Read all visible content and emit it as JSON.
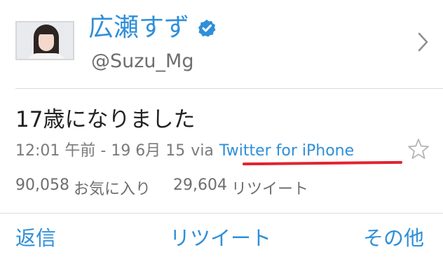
{
  "profile": {
    "display_name": "広瀬すず",
    "handle": "@Suzu_Mg",
    "verified_icon": "verified-check-icon",
    "avatar_icon": "profile-photo"
  },
  "tweet": {
    "text": "17歳になりました",
    "timestamp": "12:01 午前 - 19 6月 15",
    "via": "via",
    "source": "Twitter for iPhone",
    "favorite_icon": "star-icon"
  },
  "stats": {
    "favorites_count": "90,058",
    "favorites_label": "お気に入り",
    "retweets_count": "29,604",
    "retweets_label": "リツイート"
  },
  "actions": {
    "reply": "返信",
    "retweet": "リツイート",
    "more": "その他"
  },
  "colors": {
    "accent": "#2f8fd8",
    "annotation": "#e0242f",
    "text": "#222222",
    "muted": "#7a7a7a"
  }
}
